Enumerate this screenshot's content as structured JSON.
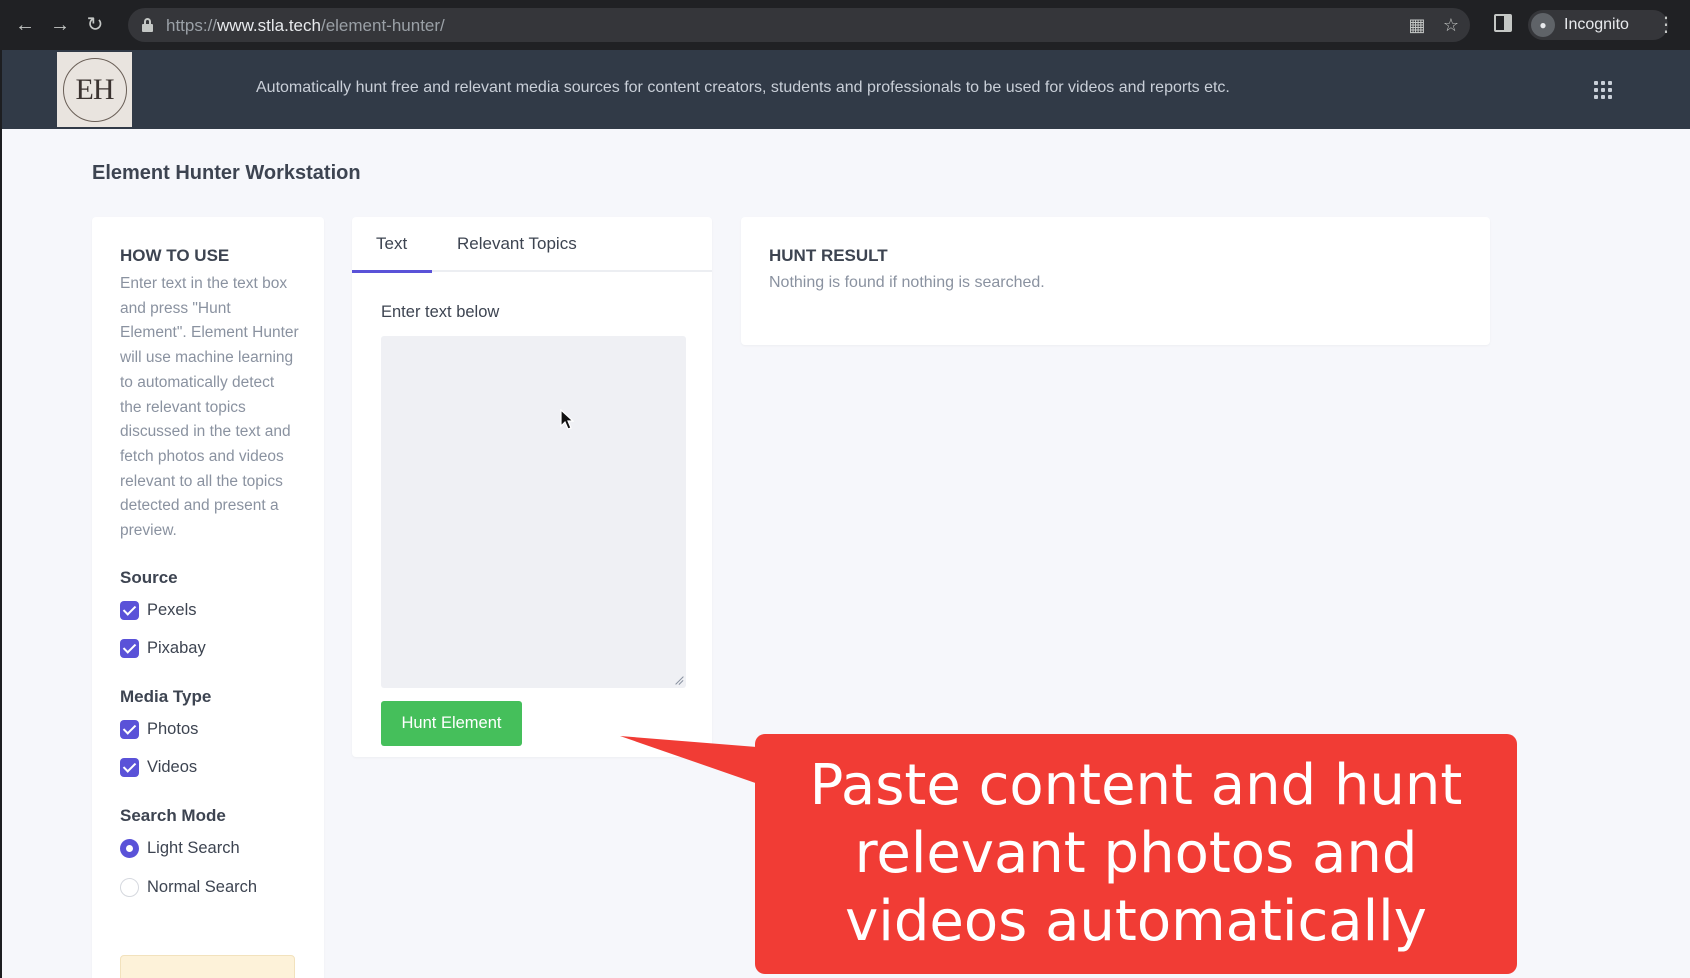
{
  "browser": {
    "url_prefix": "https://",
    "url_domain": "www.stla.tech",
    "url_path": "/element-hunter/",
    "profile_label": "Incognito"
  },
  "header": {
    "logo_text": "EH",
    "tagline": "Automatically hunt free and relevant media sources for content creators, students and professionals to be used for videos and reports etc."
  },
  "page": {
    "title": "Element Hunter Workstation"
  },
  "howto": {
    "title": "HOW TO USE",
    "body": "Enter text in the text box and press \"Hunt Element\". Element Hunter will use machine learning to automatically detect the relevant topics discussed in the text and fetch photos and videos relevant to all the topics detected and present a preview."
  },
  "source": {
    "title": "Source",
    "options": [
      {
        "label": "Pexels",
        "checked": true
      },
      {
        "label": "Pixabay",
        "checked": true
      }
    ]
  },
  "media_type": {
    "title": "Media Type",
    "options": [
      {
        "label": "Photos",
        "checked": true
      },
      {
        "label": "Videos",
        "checked": true
      }
    ]
  },
  "search_mode": {
    "title": "Search Mode",
    "options": [
      {
        "label": "Light Search",
        "selected": true
      },
      {
        "label": "Normal Search",
        "selected": false
      }
    ]
  },
  "input_panel": {
    "tabs": [
      {
        "label": "Text",
        "active": true
      },
      {
        "label": "Relevant Topics",
        "active": false
      }
    ],
    "field_label": "Enter text below",
    "textarea_value": "",
    "hunt_button": "Hunt Element"
  },
  "result": {
    "title": "HUNT RESULT",
    "empty_text": "Nothing is found if nothing is searched."
  },
  "annotation": {
    "text": "Paste content and hunt relevant photos and videos automatically"
  },
  "colors": {
    "accent": "#5a52d8",
    "success": "#45bf5b",
    "header_bg": "#313a47",
    "callout": "#f13c35"
  },
  "icons": [
    "back-icon",
    "forward-icon",
    "reload-icon",
    "lock-icon",
    "qr-icon",
    "bookmark-star-icon",
    "side-panel-icon",
    "incognito-icon",
    "more-icon",
    "apps-grid-icon",
    "cursor-icon"
  ]
}
